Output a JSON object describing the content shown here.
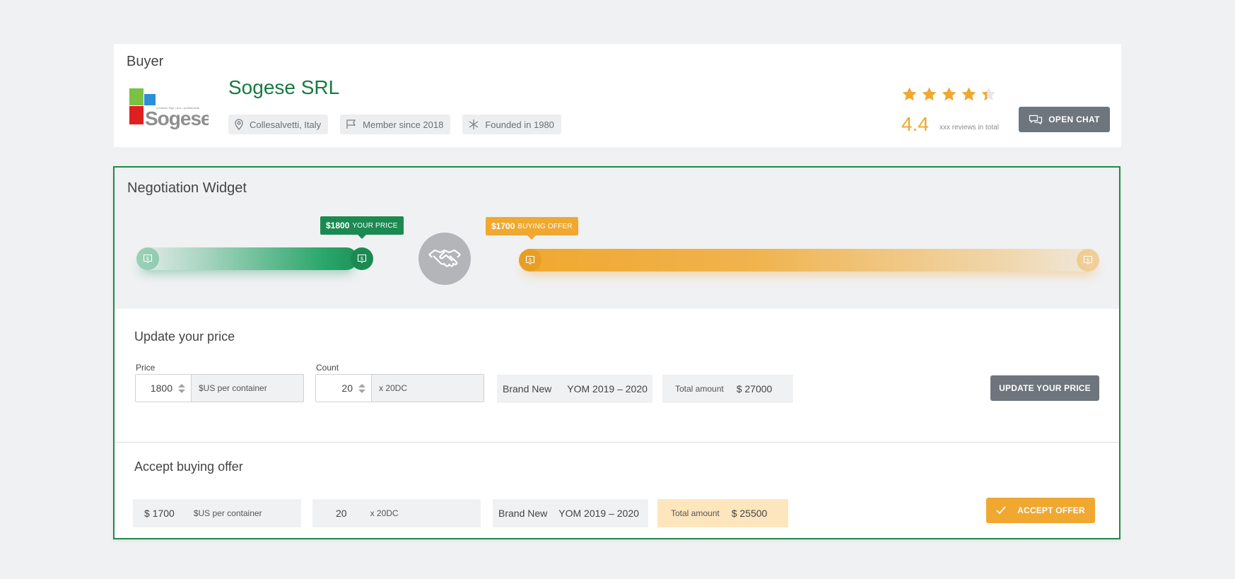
{
  "buyer": {
    "section_title": "Buyer",
    "company_name": "Sogese SRL",
    "logo_text": "Sogese",
    "logo_tagline": "container frigo • box • prefabbricati",
    "location": "Collesalvetti, Italy",
    "member_since": "Member since 2018",
    "founded": "Founded in 1980",
    "rating": "4.4",
    "rating_value": 4.4,
    "rating_max": 5,
    "reviews": "xxx reviews in total",
    "open_chat_label": "OPEN CHAT"
  },
  "widget": {
    "title": "Negotiation Widget",
    "your_price_tag": "$1800",
    "your_price_caption": "YOUR PRICE",
    "buying_offer_tag": "$1700",
    "buying_offer_caption": "BUYING OFFER"
  },
  "update": {
    "title": "Update your price",
    "price_label": "Price",
    "price_value": "1800",
    "price_unit": "$US per container",
    "count_label": "Count",
    "count_value": "20",
    "count_unit": "x 20DC",
    "condition": "Brand New",
    "yom": "YOM 2019 – 2020",
    "total_label": "Total amount",
    "total_value": "$ 27000",
    "button_label": "UPDATE YOUR PRICE"
  },
  "accept": {
    "title": "Accept buying offer",
    "price_value": "$ 1700",
    "price_unit": "$US per container",
    "count_value": "20",
    "count_unit": "x 20DC",
    "condition": "Brand New",
    "yom": "YOM 2019 – 2020",
    "total_label": "Total amount",
    "total_value": "$ 25500",
    "button_label": "ACCEPT OFFER"
  },
  "colors": {
    "green": "#1b8a52",
    "orange": "#f0a830",
    "gray_button": "#6e757d"
  }
}
